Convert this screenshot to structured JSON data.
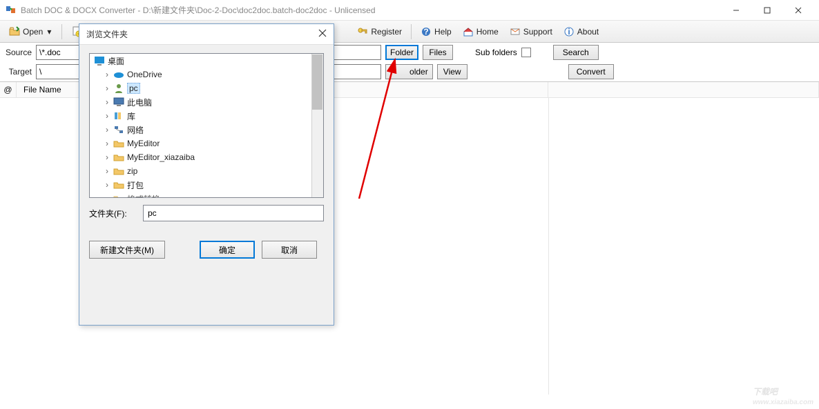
{
  "window": {
    "title": "Batch DOC & DOCX Converter - D:\\新建文件夹\\Doc-2-Doc\\doc2doc.batch-doc2doc - Unlicensed"
  },
  "toolbar": {
    "open": "Open",
    "register": "Register",
    "help": "Help",
    "home": "Home",
    "support": "Support",
    "about": "About"
  },
  "form": {
    "source_label": "Source",
    "source_value": "\\*.doc",
    "target_label": "Target",
    "target_value": "\\",
    "folder": "Folder",
    "files": "Files",
    "subfolders": "Sub folders",
    "search": "Search",
    "view": "View",
    "convert": "Convert"
  },
  "list": {
    "at": "@",
    "filename": "File Name"
  },
  "dialog": {
    "title": "浏览文件夹",
    "root": "桌面",
    "items": [
      "OneDrive",
      "pc",
      "此电脑",
      "库",
      "网络",
      "MyEditor",
      "MyEditor_xiazaiba",
      "zip",
      "打包",
      "格式转换"
    ],
    "folder_label": "文件夹(F):",
    "folder_value": "pc",
    "newfolder": "新建文件夹(M)",
    "ok": "确定",
    "cancel": "取消"
  },
  "watermark": {
    "big": "下载吧",
    "small": "www.xiazaiba.com"
  }
}
